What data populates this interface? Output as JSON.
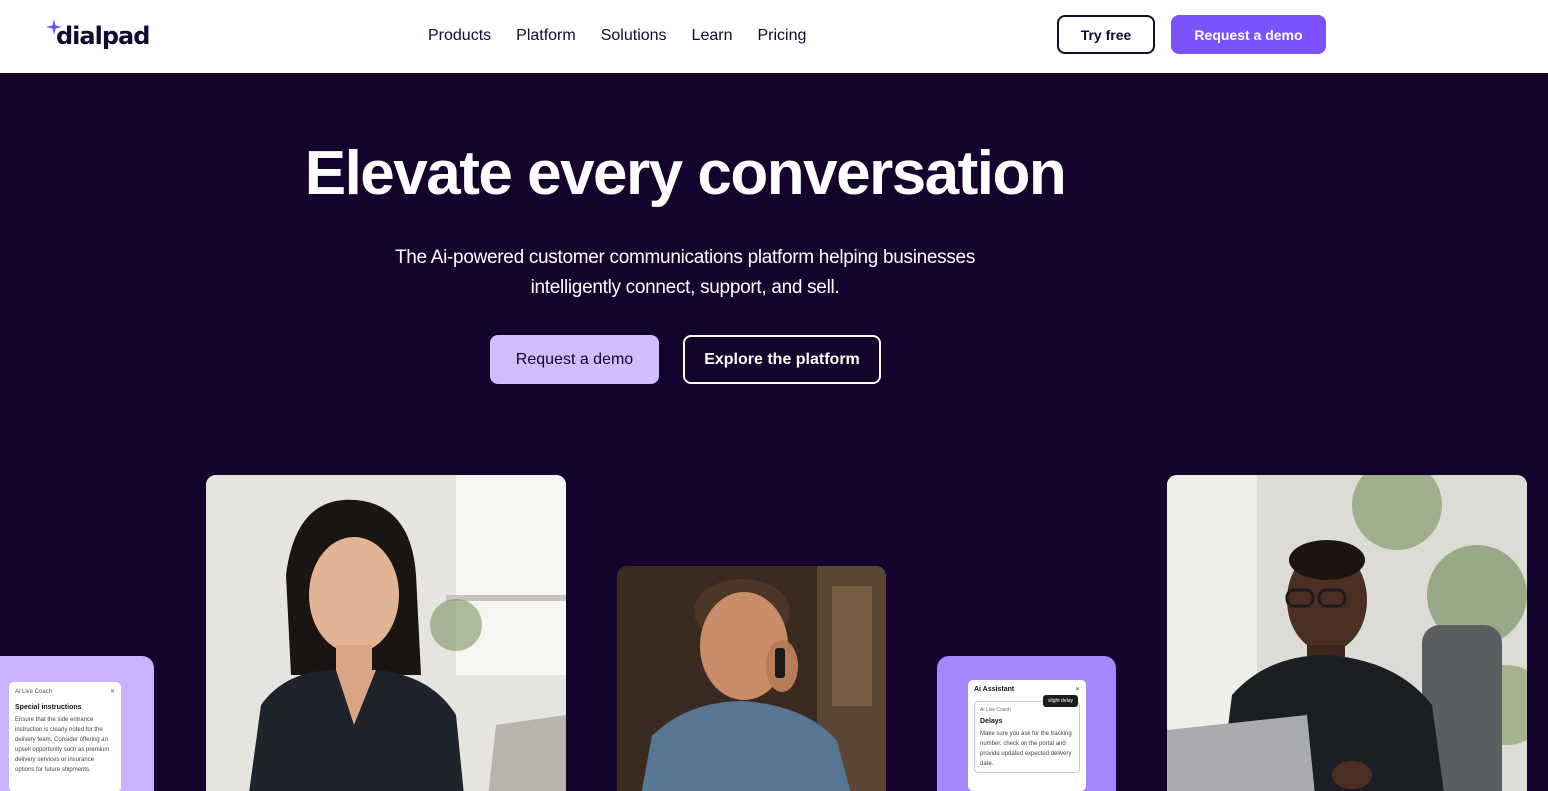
{
  "header": {
    "logo_text": "dialpad",
    "nav": [
      "Products",
      "Platform",
      "Solutions",
      "Learn",
      "Pricing"
    ],
    "try_free": "Try free",
    "request_demo": "Request a demo"
  },
  "hero": {
    "title": "Elevate every conversation",
    "subtitle": "The Ai-powered customer communications platform helping businesses intelligently connect, support, and sell.",
    "primary_button": "Request a demo",
    "secondary_button": "Explore the platform"
  },
  "cards": {
    "left_panel": {
      "header": "Ai Live Coach",
      "title": "Special instructions",
      "body": "Ensure that the side entrance instruction is clearly noted for the delivery team. Consider offering an upsell opportunity such as premium delivery services or insurance options for future shipments."
    },
    "right_panel": {
      "header": "Ai Assistant",
      "badge": "slight delay",
      "inner_header": "Ai Live Coach",
      "title": "Delays",
      "body": "Make sure you ask for the tracking number, check on the portal and provide updated expected delivery date."
    }
  },
  "colors": {
    "brand_purple": "#7c52ff",
    "hero_bg": "#14032c",
    "lavender": "#d2bdfc",
    "text_dark": "#14092e"
  }
}
